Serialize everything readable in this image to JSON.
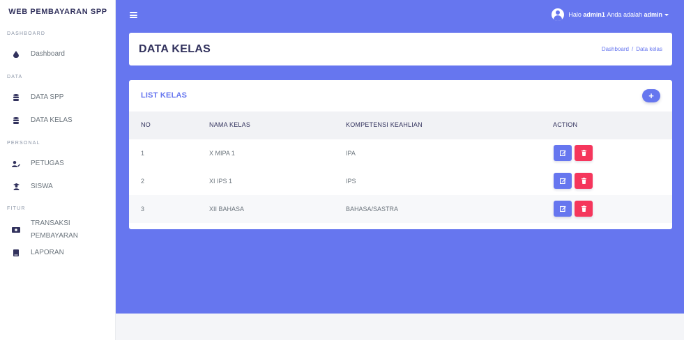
{
  "sidebar": {
    "brand": "WEB PEMBAYARAN SPP",
    "sections": [
      {
        "title": "DASHBOARD",
        "items": [
          {
            "label": "Dashboard",
            "icon": "drop-icon"
          }
        ]
      },
      {
        "title": "DATA",
        "items": [
          {
            "label": "DATA SPP",
            "icon": "database-icon"
          },
          {
            "label": "DATA KELAS",
            "icon": "database-icon"
          }
        ]
      },
      {
        "title": "PERSONAL",
        "items": [
          {
            "label": "PETUGAS",
            "icon": "user-edit-icon"
          },
          {
            "label": "SISWA",
            "icon": "graduate-icon"
          }
        ]
      },
      {
        "title": "FITUR",
        "items": [
          {
            "label": "TRANSAKSI PEMBAYARAN",
            "icon": "money-icon"
          },
          {
            "label": "LAPORAN",
            "icon": "book-icon"
          }
        ]
      }
    ]
  },
  "topbar": {
    "greeting": "Halo",
    "username": "admin1",
    "role_prefix": "Anda adalah",
    "role": "admin"
  },
  "header": {
    "title": "DATA KELAS",
    "breadcrumb": [
      "Dashboard",
      "Data kelas"
    ],
    "breadcrumb_sep": "/"
  },
  "list": {
    "title": "LIST KELAS",
    "add_label": "+",
    "columns": [
      "NO",
      "NAMA KELAS",
      "KOMPETENSI KEAHLIAN",
      "ACTION"
    ],
    "rows": [
      {
        "no": "1",
        "nama": "X MIPA 1",
        "kompetensi": "IPA"
      },
      {
        "no": "2",
        "nama": "XI IPS 1",
        "kompetensi": "IPS"
      },
      {
        "no": "3",
        "nama": "XII BAHASA",
        "kompetensi": "BAHASA/SASTRA"
      }
    ]
  },
  "colors": {
    "primary": "#6676ef",
    "danger": "#f5365c",
    "text_dark": "#32325d"
  }
}
